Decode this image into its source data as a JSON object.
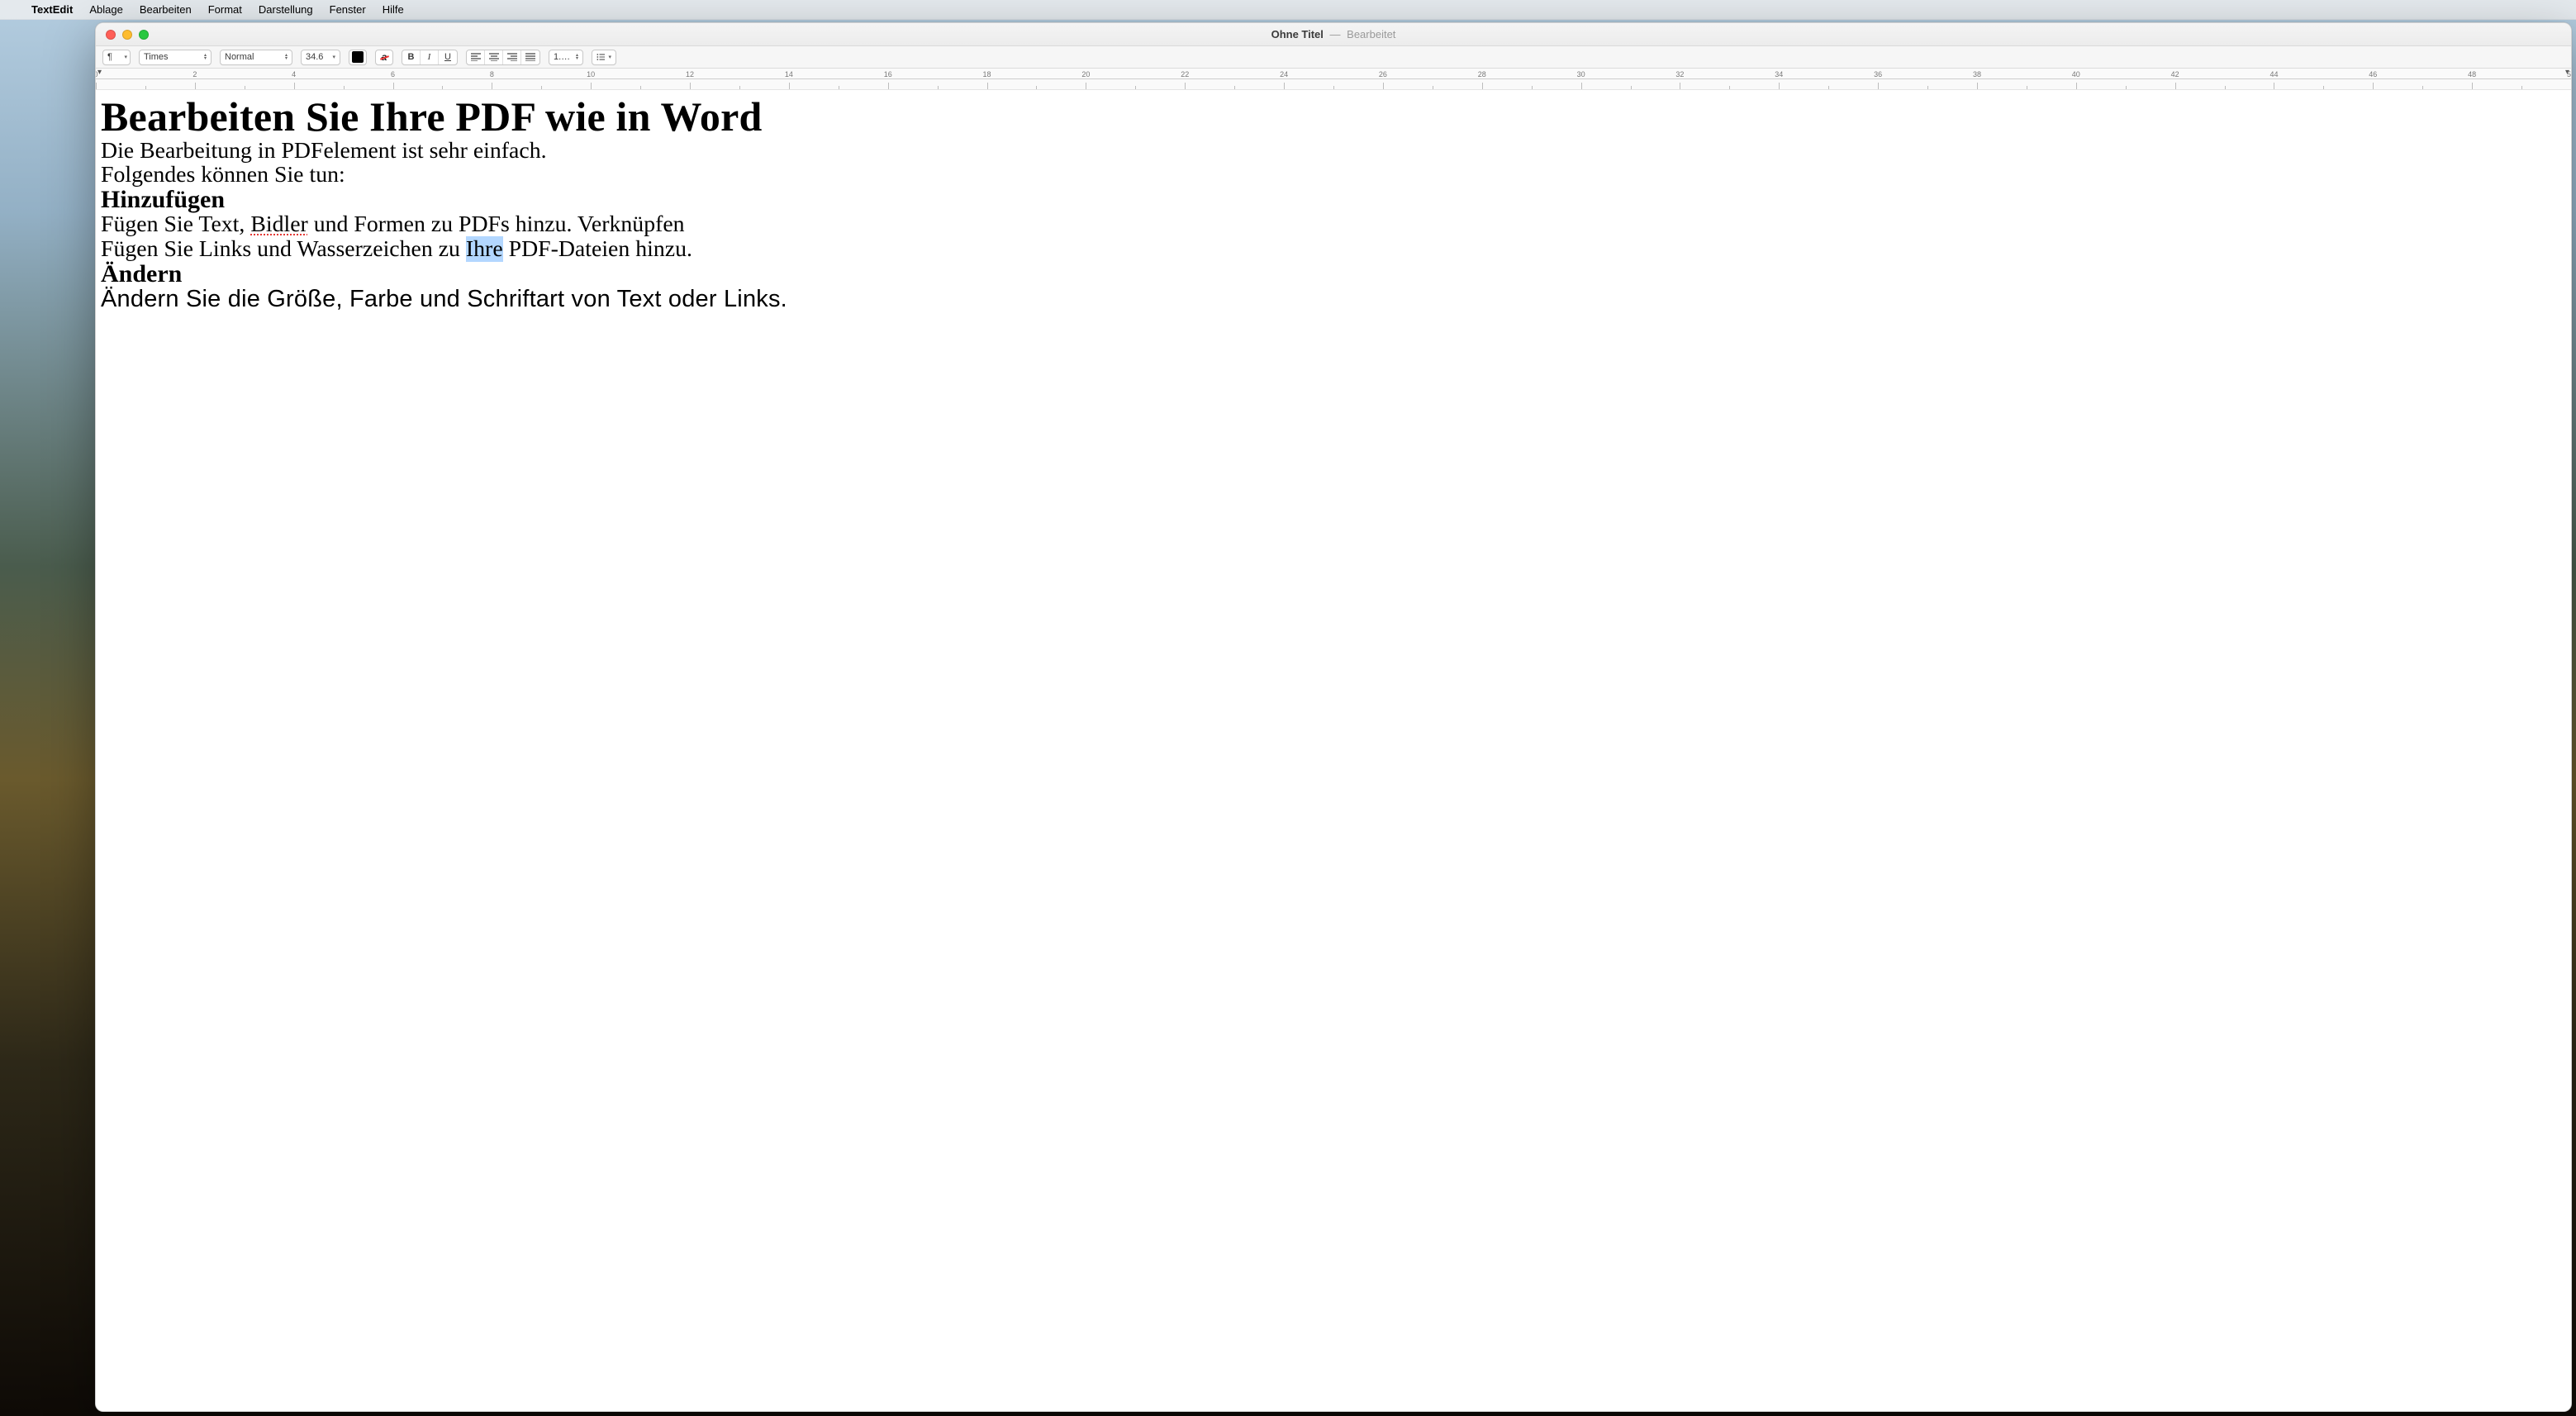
{
  "menubar": {
    "apple": "",
    "app": "TextEdit",
    "items": [
      "Ablage",
      "Bearbeiten",
      "Format",
      "Darstellung",
      "Fenster",
      "Hilfe"
    ]
  },
  "titlebar": {
    "doc_title": "Ohne Titel",
    "dash": "—",
    "state": "Bearbeitet"
  },
  "toolbar": {
    "paragraph_style": "¶",
    "font_family": "Times",
    "style_name": "Normal",
    "font_size": "34.6",
    "bold": "B",
    "italic": "I",
    "underline": "U",
    "line_spacing": "1.…",
    "color_swatch": "#000000",
    "font_color_letter": "a"
  },
  "ruler": {
    "start": 0,
    "end": 50,
    "major_step": 2
  },
  "document": {
    "h1": "Bearbeiten Sie Ihre PDF wie in Word",
    "body1": "Die Bearbeitung in PDFelement ist sehr einfach.",
    "body2": "Folgendes können Sie tun:",
    "h2a": "Hinzufügen",
    "body3_pre": "Fügen Sie Text, ",
    "body3_err": "Bidler",
    "body3_post": " und Formen zu PDFs hinzu. Verknüpfen",
    "body4_pre": "Fügen Sie Links und Wasserzeichen zu ",
    "body4_sel": "Ihre",
    "body4_post": " PDF-Dateien hinzu.",
    "h2b": "Ändern",
    "body5": "Ändern Sie die Größe, Farbe und Schriftart von Text oder Links."
  }
}
